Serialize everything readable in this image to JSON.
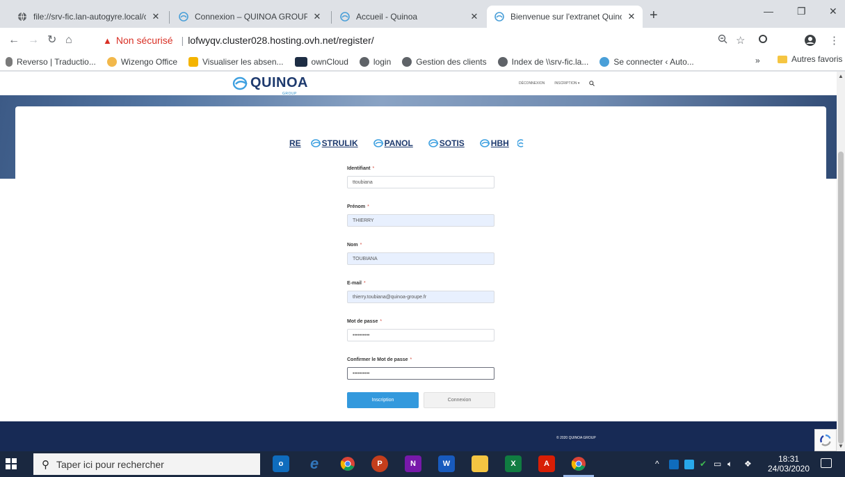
{
  "browser": {
    "tabs": [
      {
        "title": "file://srv-fic.lan-autogyre.local/co",
        "icon": "globe-icon"
      },
      {
        "title": "Connexion – QUINOA GROUP",
        "icon": "quinoa-icon"
      },
      {
        "title": "Accueil - Quinoa",
        "icon": "quinoa-icon"
      },
      {
        "title": "Bienvenue sur l'extranet Quinoa",
        "icon": "quinoa-icon"
      }
    ],
    "new_tab": "+",
    "security_text": "Non sécurisé",
    "url": "lofwyqv.cluster028.hosting.ovh.net/register/",
    "bookmarks": [
      {
        "label": "Reverso | Traductio...",
        "color": "#7a7a7a"
      },
      {
        "label": "Wizengo Office",
        "color": "#f2b84b"
      },
      {
        "label": "Visualiser les absen...",
        "color": "#f4b400"
      },
      {
        "label": "ownCloud",
        "color": "#1d2d44"
      },
      {
        "label": "login",
        "color": "#5f6368"
      },
      {
        "label": "Gestion des clients",
        "color": "#5f6368"
      },
      {
        "label": "Index de \\\\srv-fic.la...",
        "color": "#5f6368"
      },
      {
        "label": "Se connecter ‹ Auto...",
        "color": "#4a9fd8"
      }
    ],
    "bookmarks_more": "»",
    "other_bookmarks": "Autres favoris"
  },
  "site": {
    "logo_text": "QUINOA",
    "logo_sub": "GROUP",
    "nav": {
      "logout": "DÉCONNEXION",
      "register": "INSCRIPTION ▾"
    },
    "brands": [
      "RE",
      "STRULIK",
      "PANOL",
      "SOTIS",
      "HBH"
    ],
    "form": {
      "fields": [
        {
          "label": "Identifiant",
          "value": "ttoubiana",
          "filled": false,
          "focused": false
        },
        {
          "label": "Prénom",
          "value": "THIERRY",
          "filled": true,
          "focused": false
        },
        {
          "label": "Nom",
          "value": "TOUBIANA",
          "filled": true,
          "focused": false
        },
        {
          "label": "E-mail",
          "value": "thierry.toubiana@quinoa-groupe.fr",
          "filled": true,
          "focused": false
        },
        {
          "label": "Mot de passe",
          "value": "••••••••••",
          "filled": false,
          "focused": false
        },
        {
          "label": "Confirmer le Mot de passe",
          "value": "••••••••••",
          "filled": false,
          "focused": true
        }
      ],
      "required_mark": "*",
      "submit_label": "Inscription",
      "login_label": "Connexion"
    },
    "footer": "© 2020 QUINOA GROUP"
  },
  "taskbar": {
    "search_placeholder": "Taper ici pour rechercher",
    "time": "18:31",
    "date": "24/03/2020",
    "apps": [
      {
        "name": "outlook",
        "letter": "o",
        "color": "#0f6cbd"
      },
      {
        "name": "edge",
        "letter": "e",
        "color": "#1a2840"
      },
      {
        "name": "chrome",
        "letter": "",
        "color": "#1a2840"
      },
      {
        "name": "powerpoint",
        "letter": "P",
        "color": "#c43e1c"
      },
      {
        "name": "onenote",
        "letter": "N",
        "color": "#7719aa"
      },
      {
        "name": "word",
        "letter": "W",
        "color": "#185abd"
      },
      {
        "name": "file-explorer",
        "letter": "",
        "color": "#f4c542"
      },
      {
        "name": "excel",
        "letter": "X",
        "color": "#107c41"
      },
      {
        "name": "acrobat",
        "letter": "A",
        "color": "#d81e05"
      },
      {
        "name": "chrome-active",
        "letter": "",
        "color": "#1a2840"
      }
    ]
  }
}
